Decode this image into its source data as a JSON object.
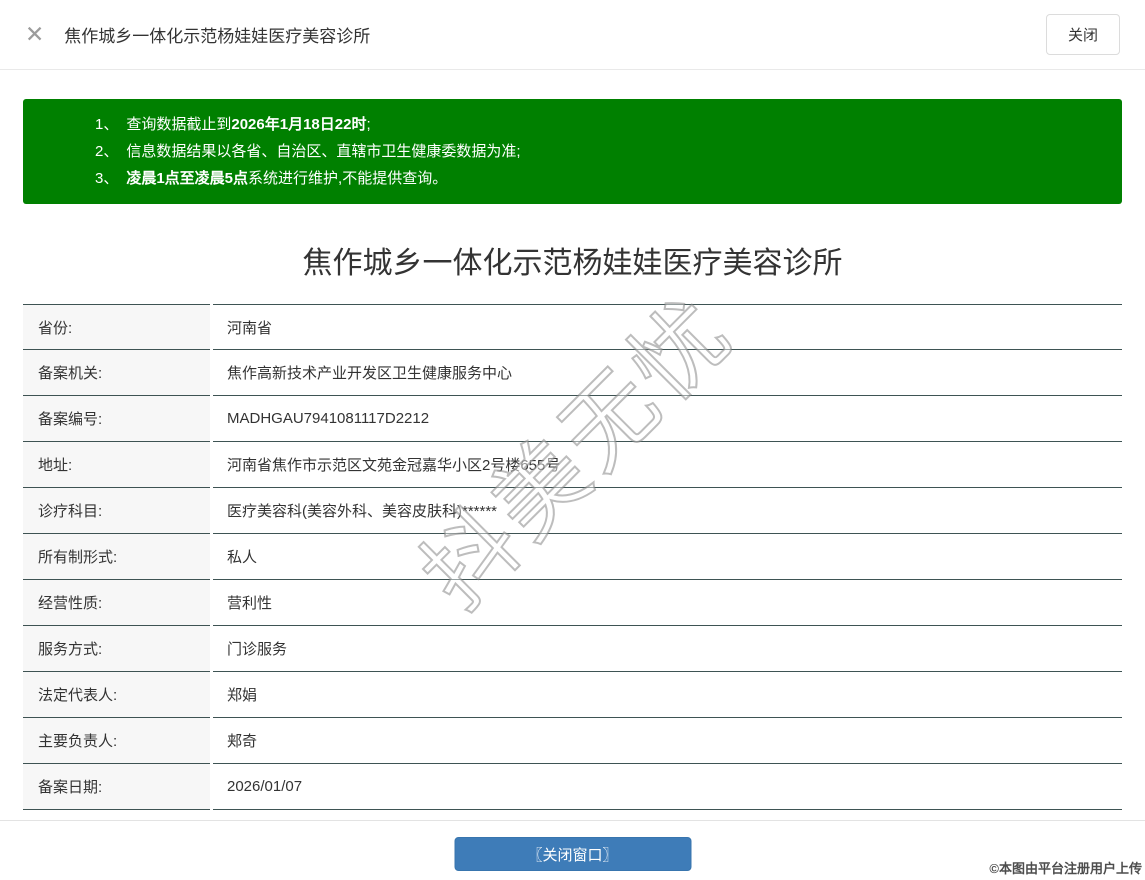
{
  "header": {
    "close_icon": "✕",
    "title": "焦作城乡一体化示范杨娃娃医疗美容诊所",
    "close_button_label": "关闭"
  },
  "notice": {
    "bg_color": "#008000",
    "lines": [
      {
        "num": "1、",
        "pre": "查询数据截止到",
        "bold": "2026年1月18日22时",
        "post": ";"
      },
      {
        "num": "2、",
        "pre": "信息数据结果以各省、自治区、直辖市卫生健康委数据为准;",
        "bold": "",
        "post": ""
      },
      {
        "num": "3、",
        "pre": "",
        "bold": "凌晨1点至凌晨5点",
        "post": "系统进行维护,不能提供查询。"
      }
    ]
  },
  "main": {
    "title": "焦作城乡一体化示范杨娃娃医疗美容诊所",
    "fields": [
      {
        "label": "省份:",
        "value": "河南省"
      },
      {
        "label": "备案机关:",
        "value": "焦作高新技术产业开发区卫生健康服务中心"
      },
      {
        "label": "备案编号:",
        "value": "MADHGAU7941081117D2212"
      },
      {
        "label": "地址:",
        "value": "河南省焦作市示范区文苑金冠嘉华小区2号楼655号"
      },
      {
        "label": "诊疗科目:",
        "value": "医疗美容科(美容外科、美容皮肤科)******"
      },
      {
        "label": "所有制形式:",
        "value": "私人"
      },
      {
        "label": "经营性质:",
        "value": "营利性"
      },
      {
        "label": "服务方式:",
        "value": "门诊服务"
      },
      {
        "label": "法定代表人:",
        "value": "郑娟"
      },
      {
        "label": "主要负责人:",
        "value": "郏奇"
      },
      {
        "label": "备案日期:",
        "value": "2026/01/07"
      }
    ]
  },
  "footer": {
    "close_window_button": "〖关闭窗口〗",
    "button_color": "#3e7cb8"
  },
  "watermark": {
    "text": "抖美无忧"
  },
  "copyright": "©本图由平台注册用户上传"
}
